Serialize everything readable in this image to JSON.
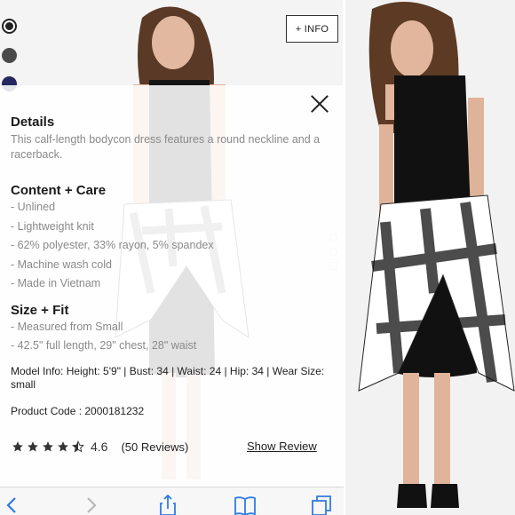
{
  "info_button": {
    "label": "+ INFO"
  },
  "swatch_colors": [
    "#222222",
    "#4a4a4a",
    "#262660",
    "#e84a4a",
    "#7ab8cf",
    "#e9c9c9",
    "#e36a6a"
  ],
  "details": {
    "heading": "Details",
    "description": "This calf-length bodycon dress features a round neckline and a racerback."
  },
  "content_care": {
    "heading": "Content + Care",
    "items": [
      "- Unlined",
      "- Lightweight knit",
      "- 62% polyester, 33% rayon, 5% spandex",
      "- Machine wash cold",
      "- Made in Vietnam"
    ]
  },
  "size_fit": {
    "heading": "Size + Fit",
    "items": [
      "- Measured from Small",
      "- 42.5\" full length, 29\" chest, 28\" waist"
    ]
  },
  "model_info": "Model Info: Height: 5'9\" | Bust: 34 | Waist: 24 | Hip: 34 | Wear Size: small",
  "product_code": "Product Code : 2000181232",
  "rating": {
    "value": "4.6",
    "stars": 4.5,
    "reviews_label": "(50 Reviews)",
    "show_review_label": "Show Review"
  },
  "toolbar": {
    "icons": [
      "back-icon",
      "forward-icon",
      "share-icon",
      "bookmarks-icon",
      "tabs-icon"
    ],
    "accent": "#2f7be5"
  }
}
